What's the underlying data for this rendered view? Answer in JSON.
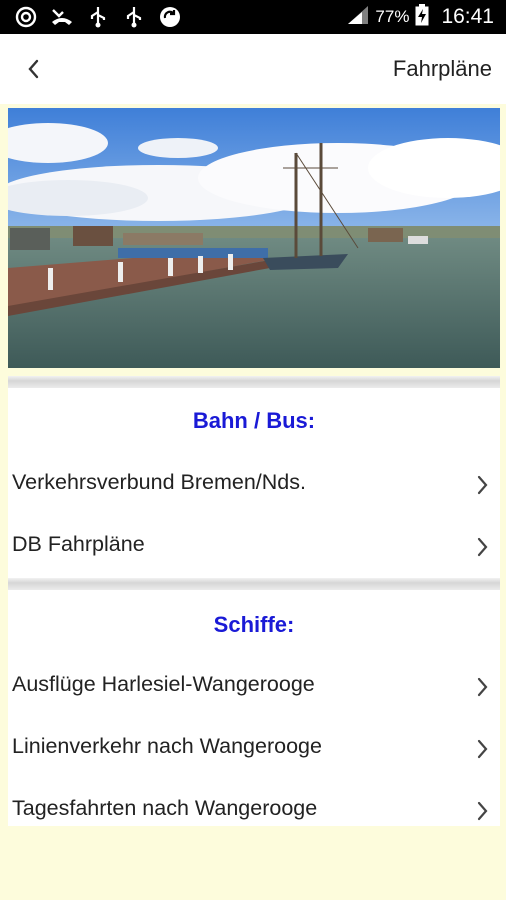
{
  "status_bar": {
    "battery_percent": "77%",
    "time": "16:41"
  },
  "app_bar": {
    "title": "Fahrpläne"
  },
  "sections": [
    {
      "heading": "Bahn / Bus:",
      "items": [
        {
          "label": "Verkehrsverbund Bremen/Nds."
        },
        {
          "label": "DB Fahrpläne"
        }
      ]
    },
    {
      "heading": "Schiffe:",
      "items": [
        {
          "label": "Ausflüge Harlesiel-Wangerooge"
        },
        {
          "label": "Linienverkehr nach Wangerooge"
        },
        {
          "label": "Tagesfahrten nach Wangerooge"
        }
      ]
    }
  ],
  "colors": {
    "heading": "#1a1ad6",
    "background": "#fdfcdc",
    "status_bar": "#000000"
  }
}
